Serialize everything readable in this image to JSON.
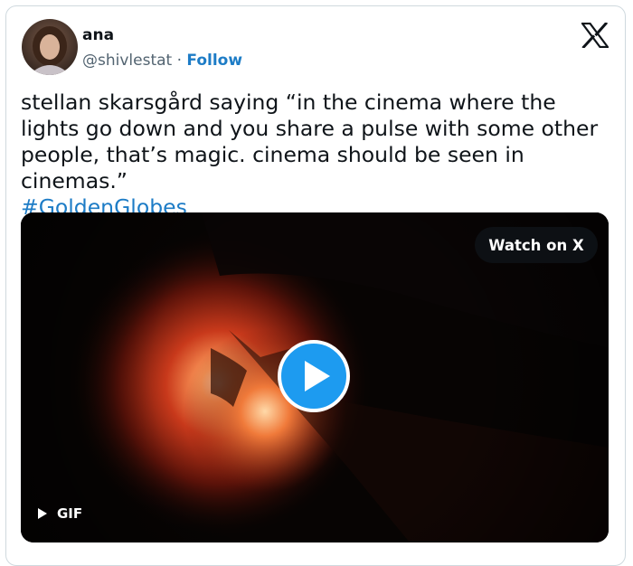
{
  "author": {
    "name": "ana",
    "handle": "@shivlestat",
    "separator": "·",
    "follow_label": "Follow"
  },
  "platform": {
    "logo_icon": "x-logo-icon"
  },
  "tweet": {
    "text": "stellan skarsgård saying “in the cinema where the lights go down and you share a pulse with some other people, that’s magic. cinema should be seen in cinemas.”",
    "hashtag": "#GoldenGlobes"
  },
  "media": {
    "watch_label": "Watch on X",
    "type_label": "GIF",
    "play_icon": "play-icon"
  },
  "colors": {
    "link": "#1d7cc6",
    "play_button": "#1d9bf0",
    "border": "#cfd9de",
    "secondary_text": "#536471"
  }
}
